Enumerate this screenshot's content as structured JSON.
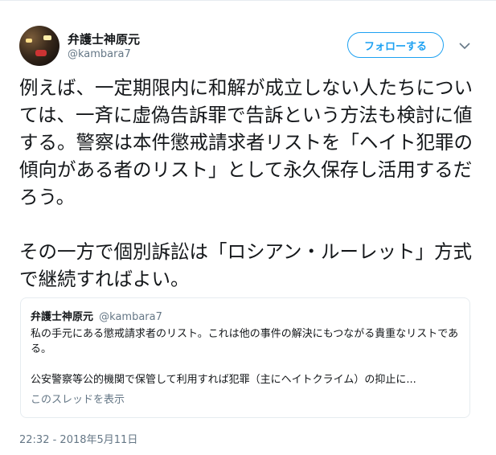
{
  "author": {
    "name": "弁護士神原元",
    "handle": "@kambara7"
  },
  "follow_label": "フォローする",
  "tweet": {
    "text": "例えば、一定期限内に和解が成立しない人たちについては、一斉に虚偽告訴罪で告訴という方法も検討に値する。警察は本件懲戒請求者リストを「ヘイト犯罪の傾向がある者のリスト」として永久保存し活用するだろう。\n\nその一方で個別訴訟は「ロシアン・ルーレット」方式で継続すればよい。",
    "timestamp": "22:32 - 2018年5月11日"
  },
  "quote": {
    "name": "弁護士神原元",
    "handle": "@kambara7",
    "body": "私の手元にある懲戒請求者のリスト。これは他の事件の解決にもつながる貴重なリストである。\n\n公安警察等公的機関で保管して利用すれば犯罪（主にヘイトクライム）の抑止に...",
    "thread_link": "このスレッドを表示"
  },
  "colors": {
    "accent": "#1da1f2",
    "secondary_text": "#657786",
    "border": "#e6ecf0"
  },
  "icons": {
    "caret": "chevron-down-icon"
  }
}
